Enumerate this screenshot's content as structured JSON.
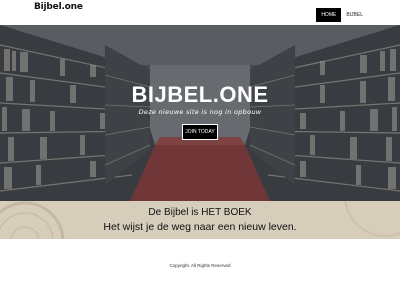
{
  "header": {
    "brand": "Bijbel.one",
    "nav": [
      {
        "label": "HOME",
        "active": true
      },
      {
        "label": "BIJBEL",
        "active": false
      }
    ]
  },
  "hero": {
    "title": "BIJBEL.ONE",
    "subtitle": "Deze nieuwe site is nog in opbouw",
    "button_label": "JOIN TODAY"
  },
  "quote": {
    "line1": "De Bijbel is HET BOEK",
    "line2": "Het wijst je de weg naar een nieuw leven."
  },
  "footer": {
    "copyright": "Copyright. All Rights Reserved"
  },
  "colors": {
    "accent": "#000000",
    "quote_band": "#d7cdbb",
    "hero_floor": "#8a3b3b"
  }
}
